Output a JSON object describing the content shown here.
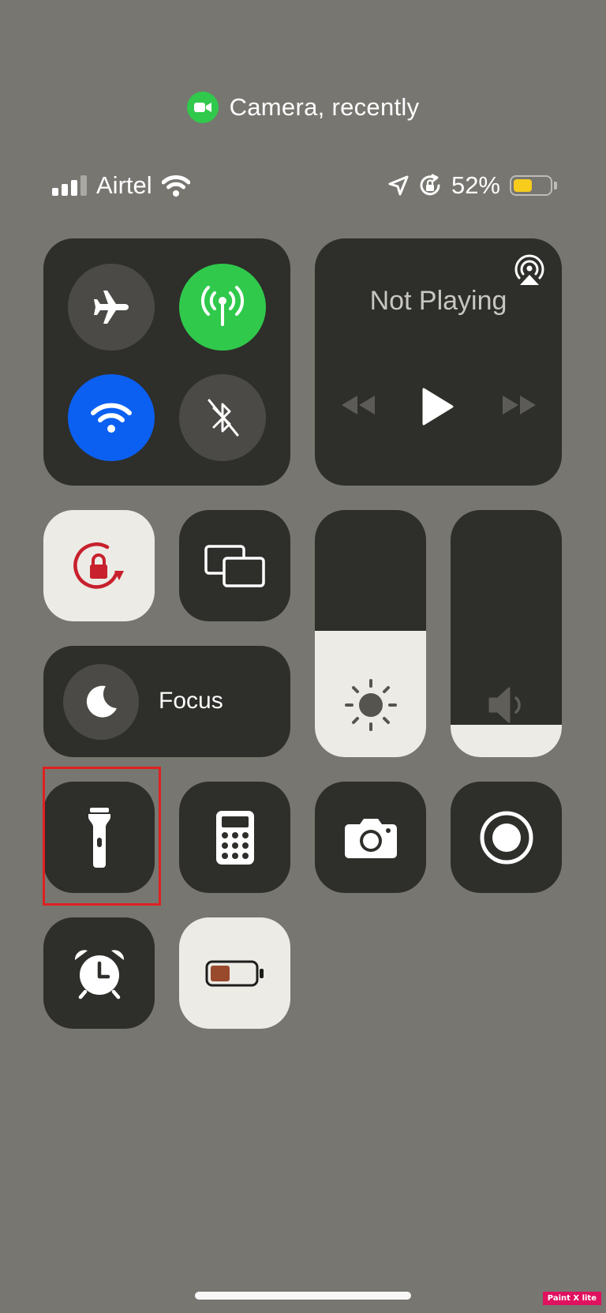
{
  "recording_indicator": {
    "text": "Camera, recently"
  },
  "status_bar": {
    "carrier": "Airtel",
    "battery_percent": "52%",
    "battery_level": 0.52,
    "battery_color": "#f7cc1c"
  },
  "media": {
    "status": "Not Playing"
  },
  "focus": {
    "label": "Focus"
  },
  "sliders": {
    "brightness_level": 0.51,
    "volume_level": 0.13
  },
  "colors": {
    "cellular_active": "#30c94c",
    "wifi_active": "#0b60f2",
    "lock_red": "#c8202d",
    "low_power_brown": "#9a4a2c"
  },
  "watermark": {
    "text": "Paint X lite"
  }
}
